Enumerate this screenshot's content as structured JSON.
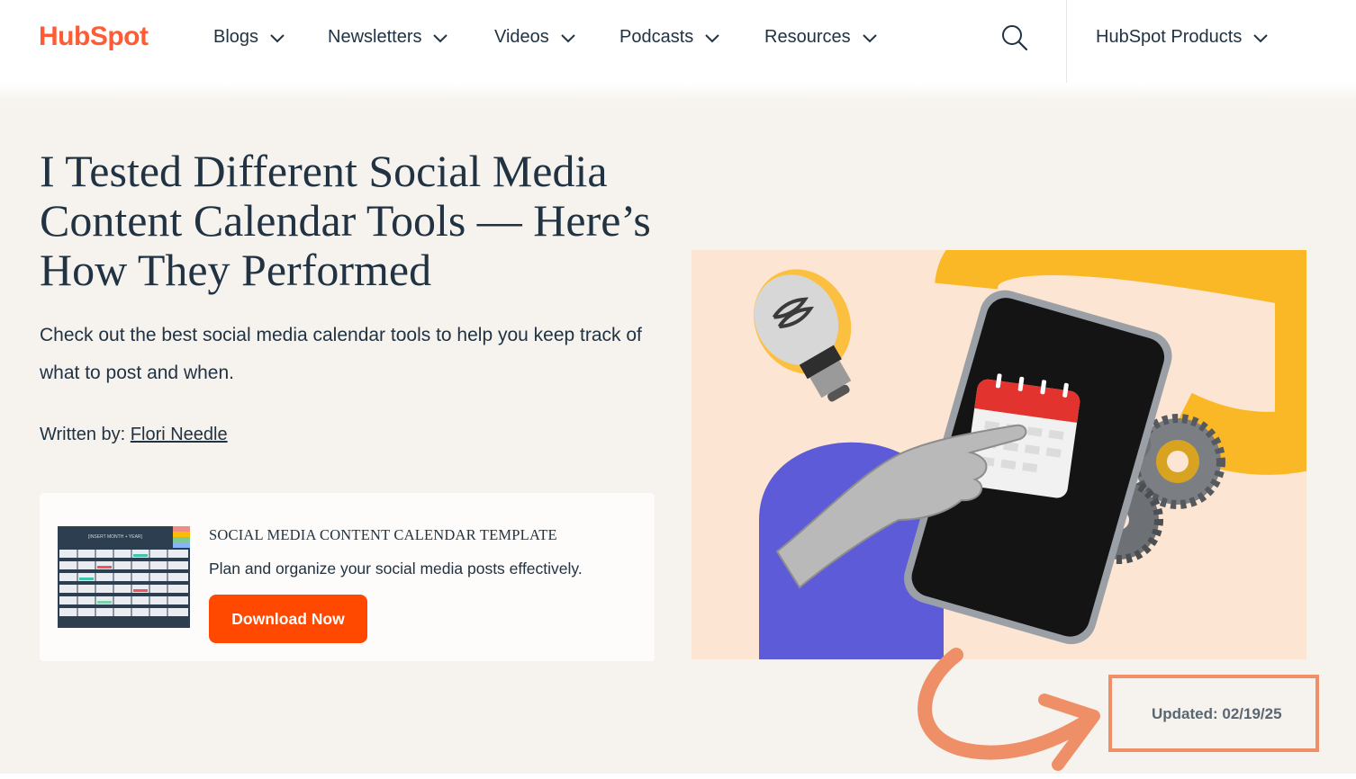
{
  "header": {
    "logo_text": "HubSpot",
    "nav_items": [
      {
        "label": "Blogs",
        "icon": "chevron-down-icon"
      },
      {
        "label": "Newsletters",
        "icon": "chevron-down-icon"
      },
      {
        "label": "Videos",
        "icon": "chevron-down-icon"
      },
      {
        "label": "Podcasts",
        "icon": "chevron-down-icon"
      },
      {
        "label": "Resources",
        "icon": "chevron-down-icon"
      }
    ],
    "search_icon": "search-icon",
    "products": {
      "label": "HubSpot Products",
      "icon": "chevron-down-icon"
    }
  },
  "article": {
    "title": "I Tested Different Social Media Content Calendar Tools — Here’s How They Performed",
    "subtitle": "Check out the best social media calendar tools to help you keep track of what to post and when.",
    "byline_prefix": "Written by:",
    "author": "Flori Needle"
  },
  "offer": {
    "thumb_header": "[INSERT MONTH + YEAR]",
    "title": "SOCIAL MEDIA CONTENT CALENDAR TEMPLATE",
    "description": "Plan and organize your social media posts effectively.",
    "button_label": "Download Now"
  },
  "annotation": {
    "updated_text": "Updated: 02/19/25"
  },
  "colors": {
    "brand_orange": "#ff5c35",
    "cta_orange": "#ff4800",
    "text_dark": "#213343",
    "hero_bg": "#f6f3ee",
    "annotation_orange": "#ef8f68"
  }
}
